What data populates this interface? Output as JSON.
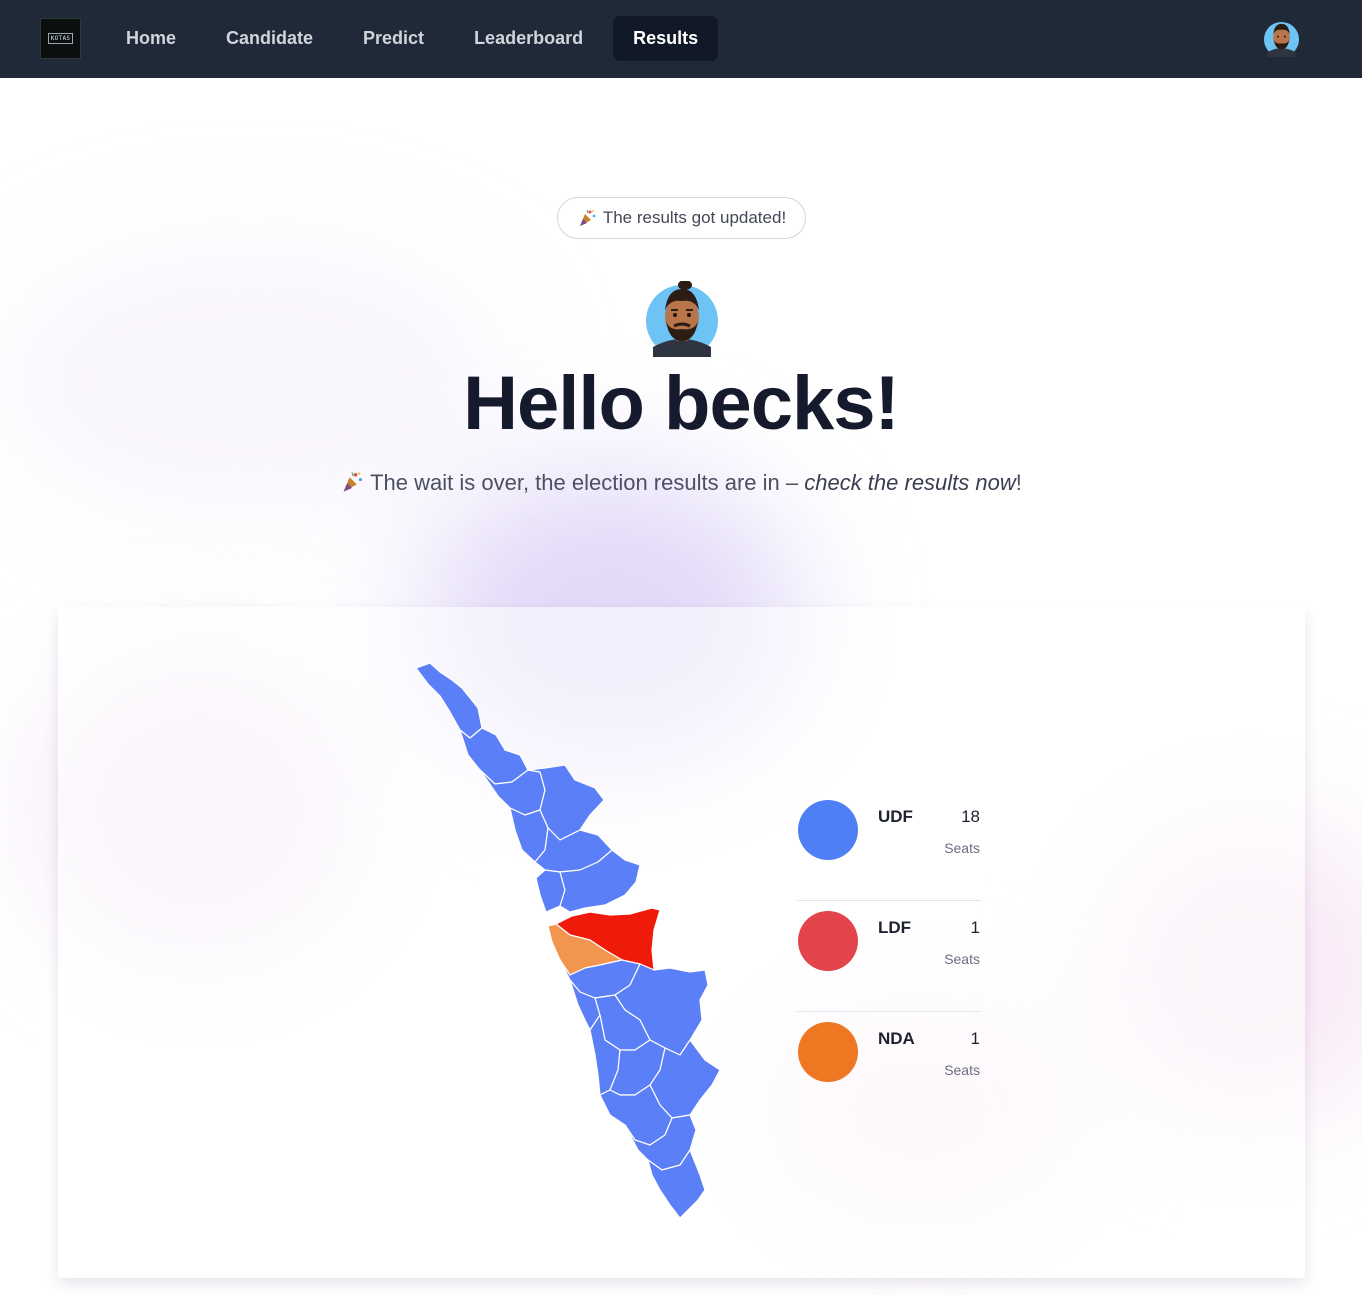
{
  "nav": {
    "logo_text": "KOTAS",
    "links": [
      {
        "label": "Home",
        "active": false
      },
      {
        "label": "Candidate",
        "active": false
      },
      {
        "label": "Predict",
        "active": false
      },
      {
        "label": "Leaderboard",
        "active": false
      },
      {
        "label": "Results",
        "active": true
      }
    ],
    "avatar_icon": "user-avatar-icon"
  },
  "hero": {
    "pill_icon": "party-popper-icon",
    "pill_text": "The results got updated!",
    "greeting": "Hello becks!",
    "subtitle_icon": "party-popper-icon",
    "subtitle_lead": "The wait is over, the election results are in – ",
    "subtitle_emphasis": "check the results now",
    "subtitle_tail": "!"
  },
  "results": {
    "parties": [
      {
        "name": "UDF",
        "seats": "18",
        "unit": "Seats",
        "color": "#4f7ff5"
      },
      {
        "name": "LDF",
        "seats": "1",
        "unit": "Seats",
        "color": "#e3434b"
      },
      {
        "name": "NDA",
        "seats": "1",
        "unit": "Seats",
        "color": "#ee7722"
      }
    ],
    "map_colors": {
      "udf": "#5b7ff7",
      "ldf": "#f01a0a",
      "nda": "#f2964f",
      "border": "#ffffff"
    }
  }
}
